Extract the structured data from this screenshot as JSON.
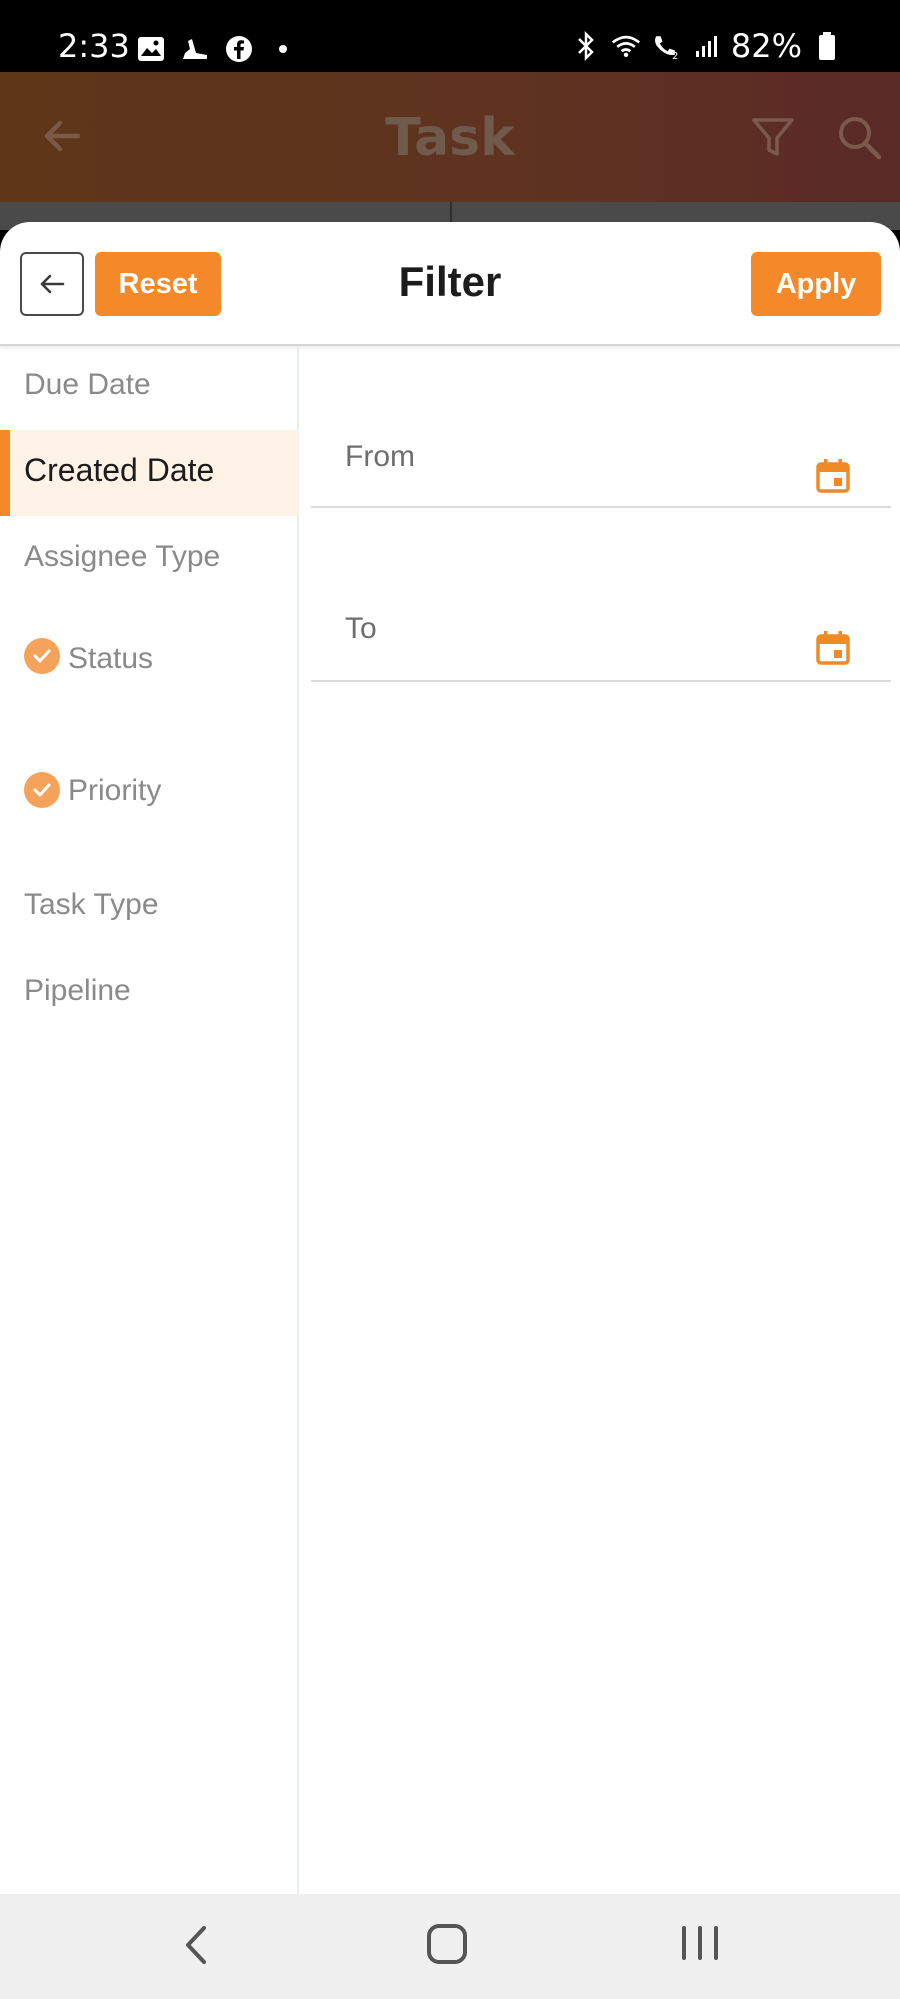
{
  "status_bar": {
    "time": "2:33",
    "battery": "82%",
    "left_icons": [
      "gallery-icon",
      "shoe-icon",
      "facebook-icon",
      "dot-icon"
    ],
    "right_icons": [
      "bluetooth-icon",
      "wifi-icon",
      "wifi-calling-icon",
      "signal-icon",
      "battery-icon"
    ]
  },
  "app_header": {
    "title": "Task",
    "icons": [
      "back-arrow-icon",
      "filter-icon",
      "search-icon"
    ],
    "background_color": "#5e3618"
  },
  "filter_sheet": {
    "title": "Filter",
    "reset_label": "Reset",
    "apply_label": "Apply",
    "accent_color": "#f5892a",
    "categories": [
      {
        "label": "Due Date",
        "active": false,
        "checked": false
      },
      {
        "label": "Created Date",
        "active": true,
        "checked": false
      },
      {
        "label": "Assignee Type",
        "active": false,
        "checked": false
      },
      {
        "label": "Status",
        "active": false,
        "checked": true
      },
      {
        "label": "Priority",
        "active": false,
        "checked": true
      },
      {
        "label": "Task Type",
        "active": false,
        "checked": false
      },
      {
        "label": "Pipeline",
        "active": false,
        "checked": false
      }
    ],
    "date_fields": [
      {
        "label": "From",
        "icon": "calendar-icon"
      },
      {
        "label": "To",
        "icon": "calendar-icon"
      }
    ]
  },
  "nav_bar": {
    "icons": [
      "nav-back-icon",
      "nav-home-icon",
      "nav-recents-icon"
    ]
  }
}
